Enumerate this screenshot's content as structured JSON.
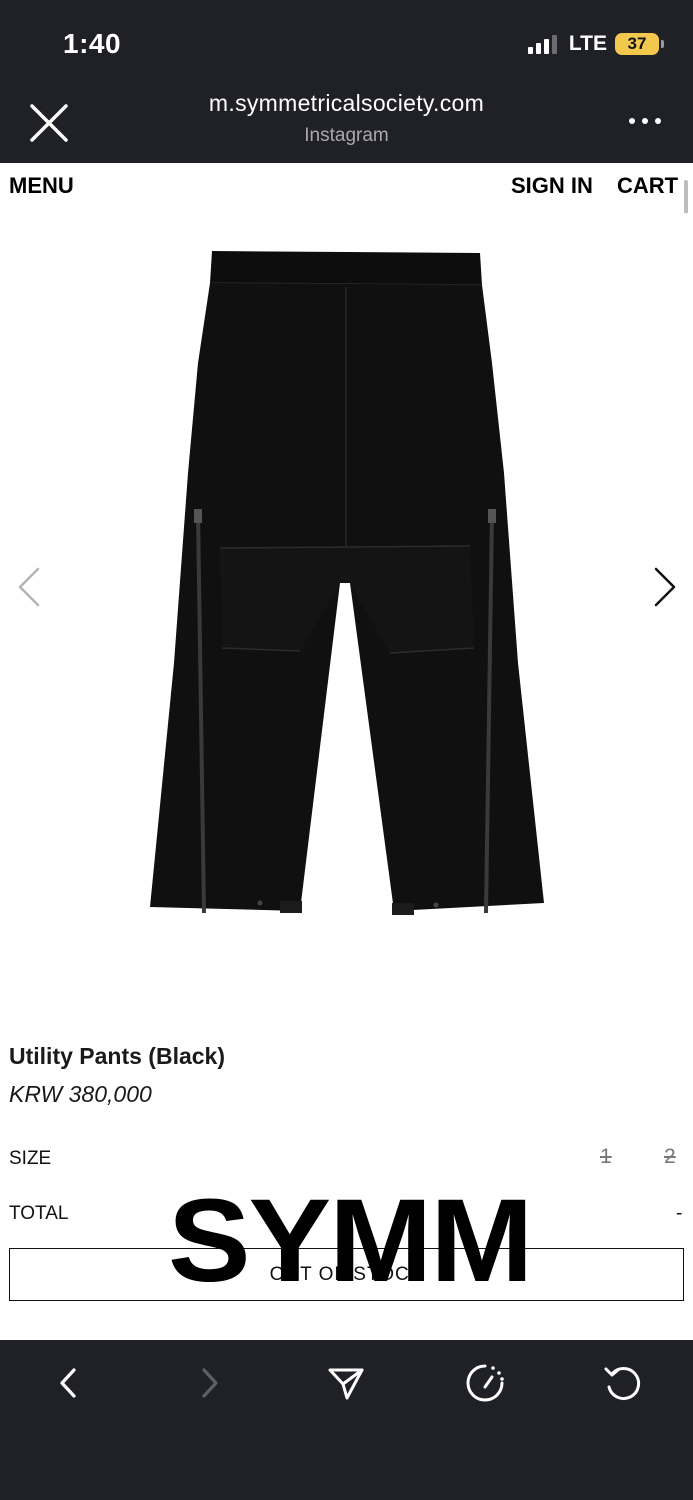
{
  "status_bar": {
    "time": "1:40",
    "network": "LTE",
    "battery": "37",
    "battery_color": "#f2c94c"
  },
  "browser": {
    "url": "m.symmetricalsociety.com",
    "source": "Instagram",
    "close_icon": "close-icon",
    "more_icon": "more-icon"
  },
  "nav": {
    "menu": "MENU",
    "sign_in": "SIGN IN",
    "cart": "CART"
  },
  "product": {
    "name": "Utility Pants (Black)",
    "price": "KRW 380,000",
    "image_alt": "Black utility pants"
  },
  "options": {
    "size_label": "SIZE",
    "sizes": [
      "1",
      "2"
    ],
    "total_label": "TOTAL",
    "total_value": "-"
  },
  "cta": {
    "label": "OUT OF STOCK"
  },
  "overlay": {
    "logo_text": "SYMM"
  },
  "toolbar": {
    "icons": [
      "back-icon",
      "forward-icon",
      "share-icon",
      "speed-icon",
      "reload-icon"
    ]
  }
}
